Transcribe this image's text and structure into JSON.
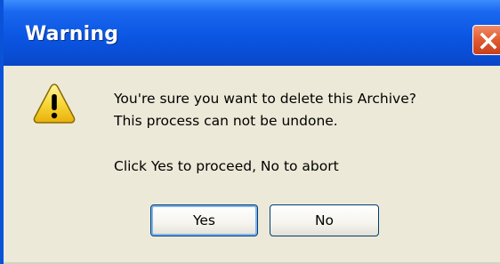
{
  "window": {
    "title": "Warning"
  },
  "message": {
    "line1": "You're sure you want to delete this Archive?",
    "line2": "This process can not be undone.",
    "line3": "Click Yes to proceed, No to abort"
  },
  "buttons": {
    "yes_label": "Yes",
    "no_label": "No"
  },
  "icons": {
    "warning": "warning-icon",
    "close": "close-icon"
  },
  "colors": {
    "titlebar": "#0b56e3",
    "dialog_bg": "#ece9d8",
    "close_button": "#e25a2f",
    "warning_fill": "#f8d838"
  }
}
